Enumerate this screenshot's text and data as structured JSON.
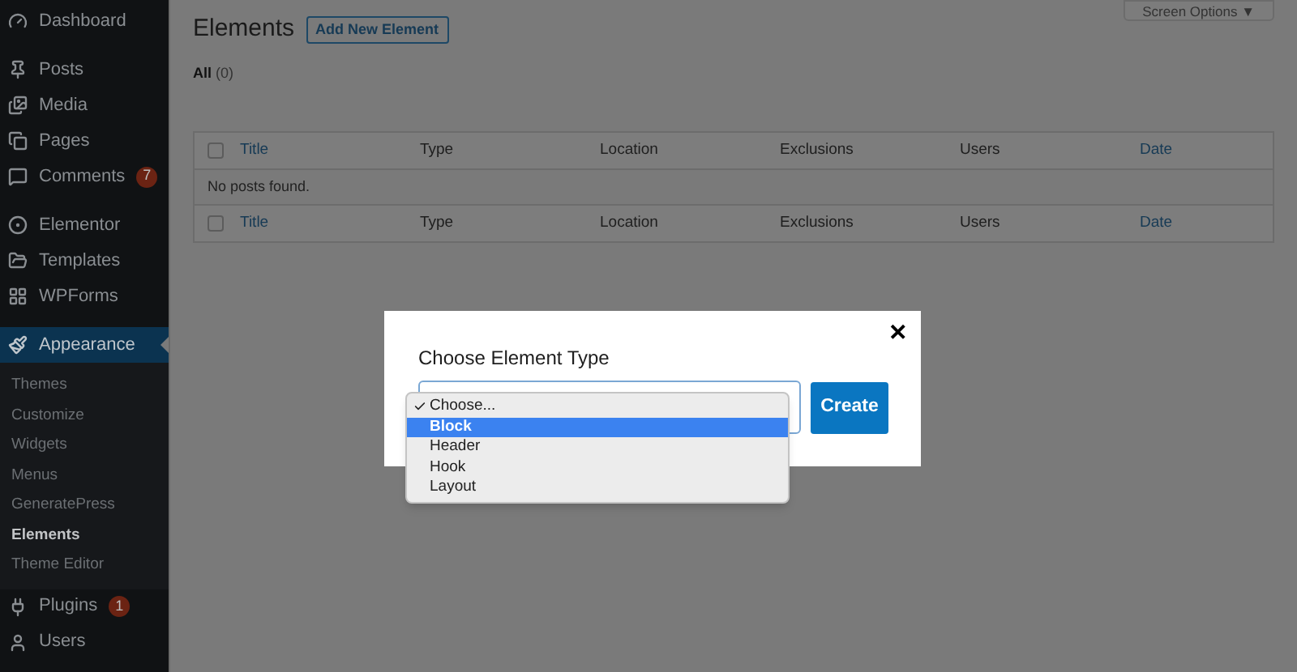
{
  "sidebar": {
    "groups": [
      {
        "items": [
          {
            "label": "Dashboard",
            "selected": false
          }
        ]
      },
      {
        "items": [
          {
            "label": "Posts",
            "selected": false
          },
          {
            "label": "Media",
            "selected": false
          },
          {
            "label": "Pages",
            "selected": false
          },
          {
            "label": "Comments",
            "badge": "7",
            "selected": false
          }
        ]
      },
      {
        "items": [
          {
            "label": "Elementor",
            "selected": false
          },
          {
            "label": "Templates",
            "selected": false
          },
          {
            "label": "WPForms",
            "selected": false
          }
        ]
      },
      {
        "items": [
          {
            "label": "Appearance",
            "selected": true,
            "children": [
              {
                "label": "Themes",
                "selected": false
              },
              {
                "label": "Customize",
                "selected": false
              },
              {
                "label": "Widgets",
                "selected": false
              },
              {
                "label": "Menus",
                "selected": false
              },
              {
                "label": "GeneratePress",
                "selected": false
              },
              {
                "label": "Elements",
                "selected": true
              },
              {
                "label": "Theme Editor",
                "selected": false
              }
            ]
          },
          {
            "label": "Plugins",
            "badge": "1",
            "selected": false
          },
          {
            "label": "Users",
            "selected": false
          }
        ]
      }
    ]
  },
  "page": {
    "title": "Elements",
    "add_button": "Add New Element",
    "screen_options": "Screen Options ▼",
    "filters": [
      {
        "label": "All",
        "count": "(0)",
        "selected": true
      }
    ]
  },
  "table": {
    "header": {
      "checked": false,
      "columns": [
        {
          "label": "Title",
          "kind": "link"
        },
        {
          "label": "Type",
          "kind": "text"
        },
        {
          "label": "Location",
          "kind": "text"
        },
        {
          "label": "Exclusions",
          "kind": "text"
        },
        {
          "label": "Users",
          "kind": "text"
        },
        {
          "label": "Date",
          "kind": "link"
        }
      ]
    },
    "empty_message": "No posts found.",
    "footer": {
      "checked": false,
      "columns": [
        {
          "label": "Title",
          "kind": "link"
        },
        {
          "label": "Type",
          "kind": "text"
        },
        {
          "label": "Location",
          "kind": "text"
        },
        {
          "label": "Exclusions",
          "kind": "text"
        },
        {
          "label": "Users",
          "kind": "text"
        },
        {
          "label": "Date",
          "kind": "link"
        }
      ]
    }
  },
  "modal": {
    "title": "Choose Element Type",
    "close": "✕",
    "create_button": "Create",
    "options": [
      {
        "label": "Choose...",
        "checked": true,
        "selected": false
      },
      {
        "label": "Block",
        "checked": false,
        "selected": true
      },
      {
        "label": "Header",
        "checked": false,
        "selected": false
      },
      {
        "label": "Hook",
        "checked": false,
        "selected": false
      },
      {
        "label": "Layout",
        "checked": false,
        "selected": false
      }
    ]
  }
}
